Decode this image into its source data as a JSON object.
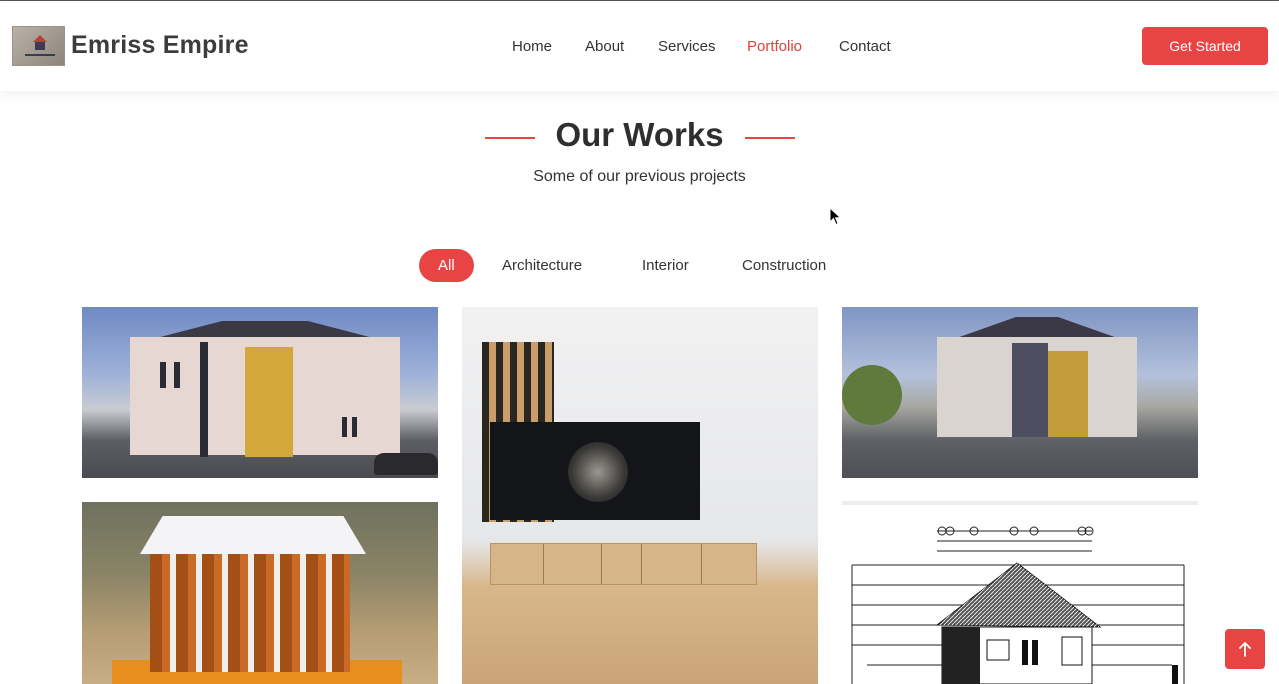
{
  "header": {
    "brand": "Emriss Empire",
    "nav": [
      {
        "label": "Home",
        "active": false
      },
      {
        "label": "About",
        "active": false
      },
      {
        "label": "Services",
        "active": false
      },
      {
        "label": "Portfolio",
        "active": true
      },
      {
        "label": "Contact",
        "active": false
      }
    ],
    "cta_label": "Get Started"
  },
  "section": {
    "title": "Our Works",
    "subtitle": "Some of our previous projects"
  },
  "filters": [
    {
      "label": "All",
      "active": true
    },
    {
      "label": "Architecture",
      "active": false
    },
    {
      "label": "Interior",
      "active": false
    },
    {
      "label": "Construction",
      "active": false
    }
  ],
  "colors": {
    "accent": "#e84444",
    "text": "#333333",
    "heading": "#2e2e2e"
  },
  "icons": {
    "scroll_top": "arrow-up-icon",
    "logo": "logo-icon"
  }
}
